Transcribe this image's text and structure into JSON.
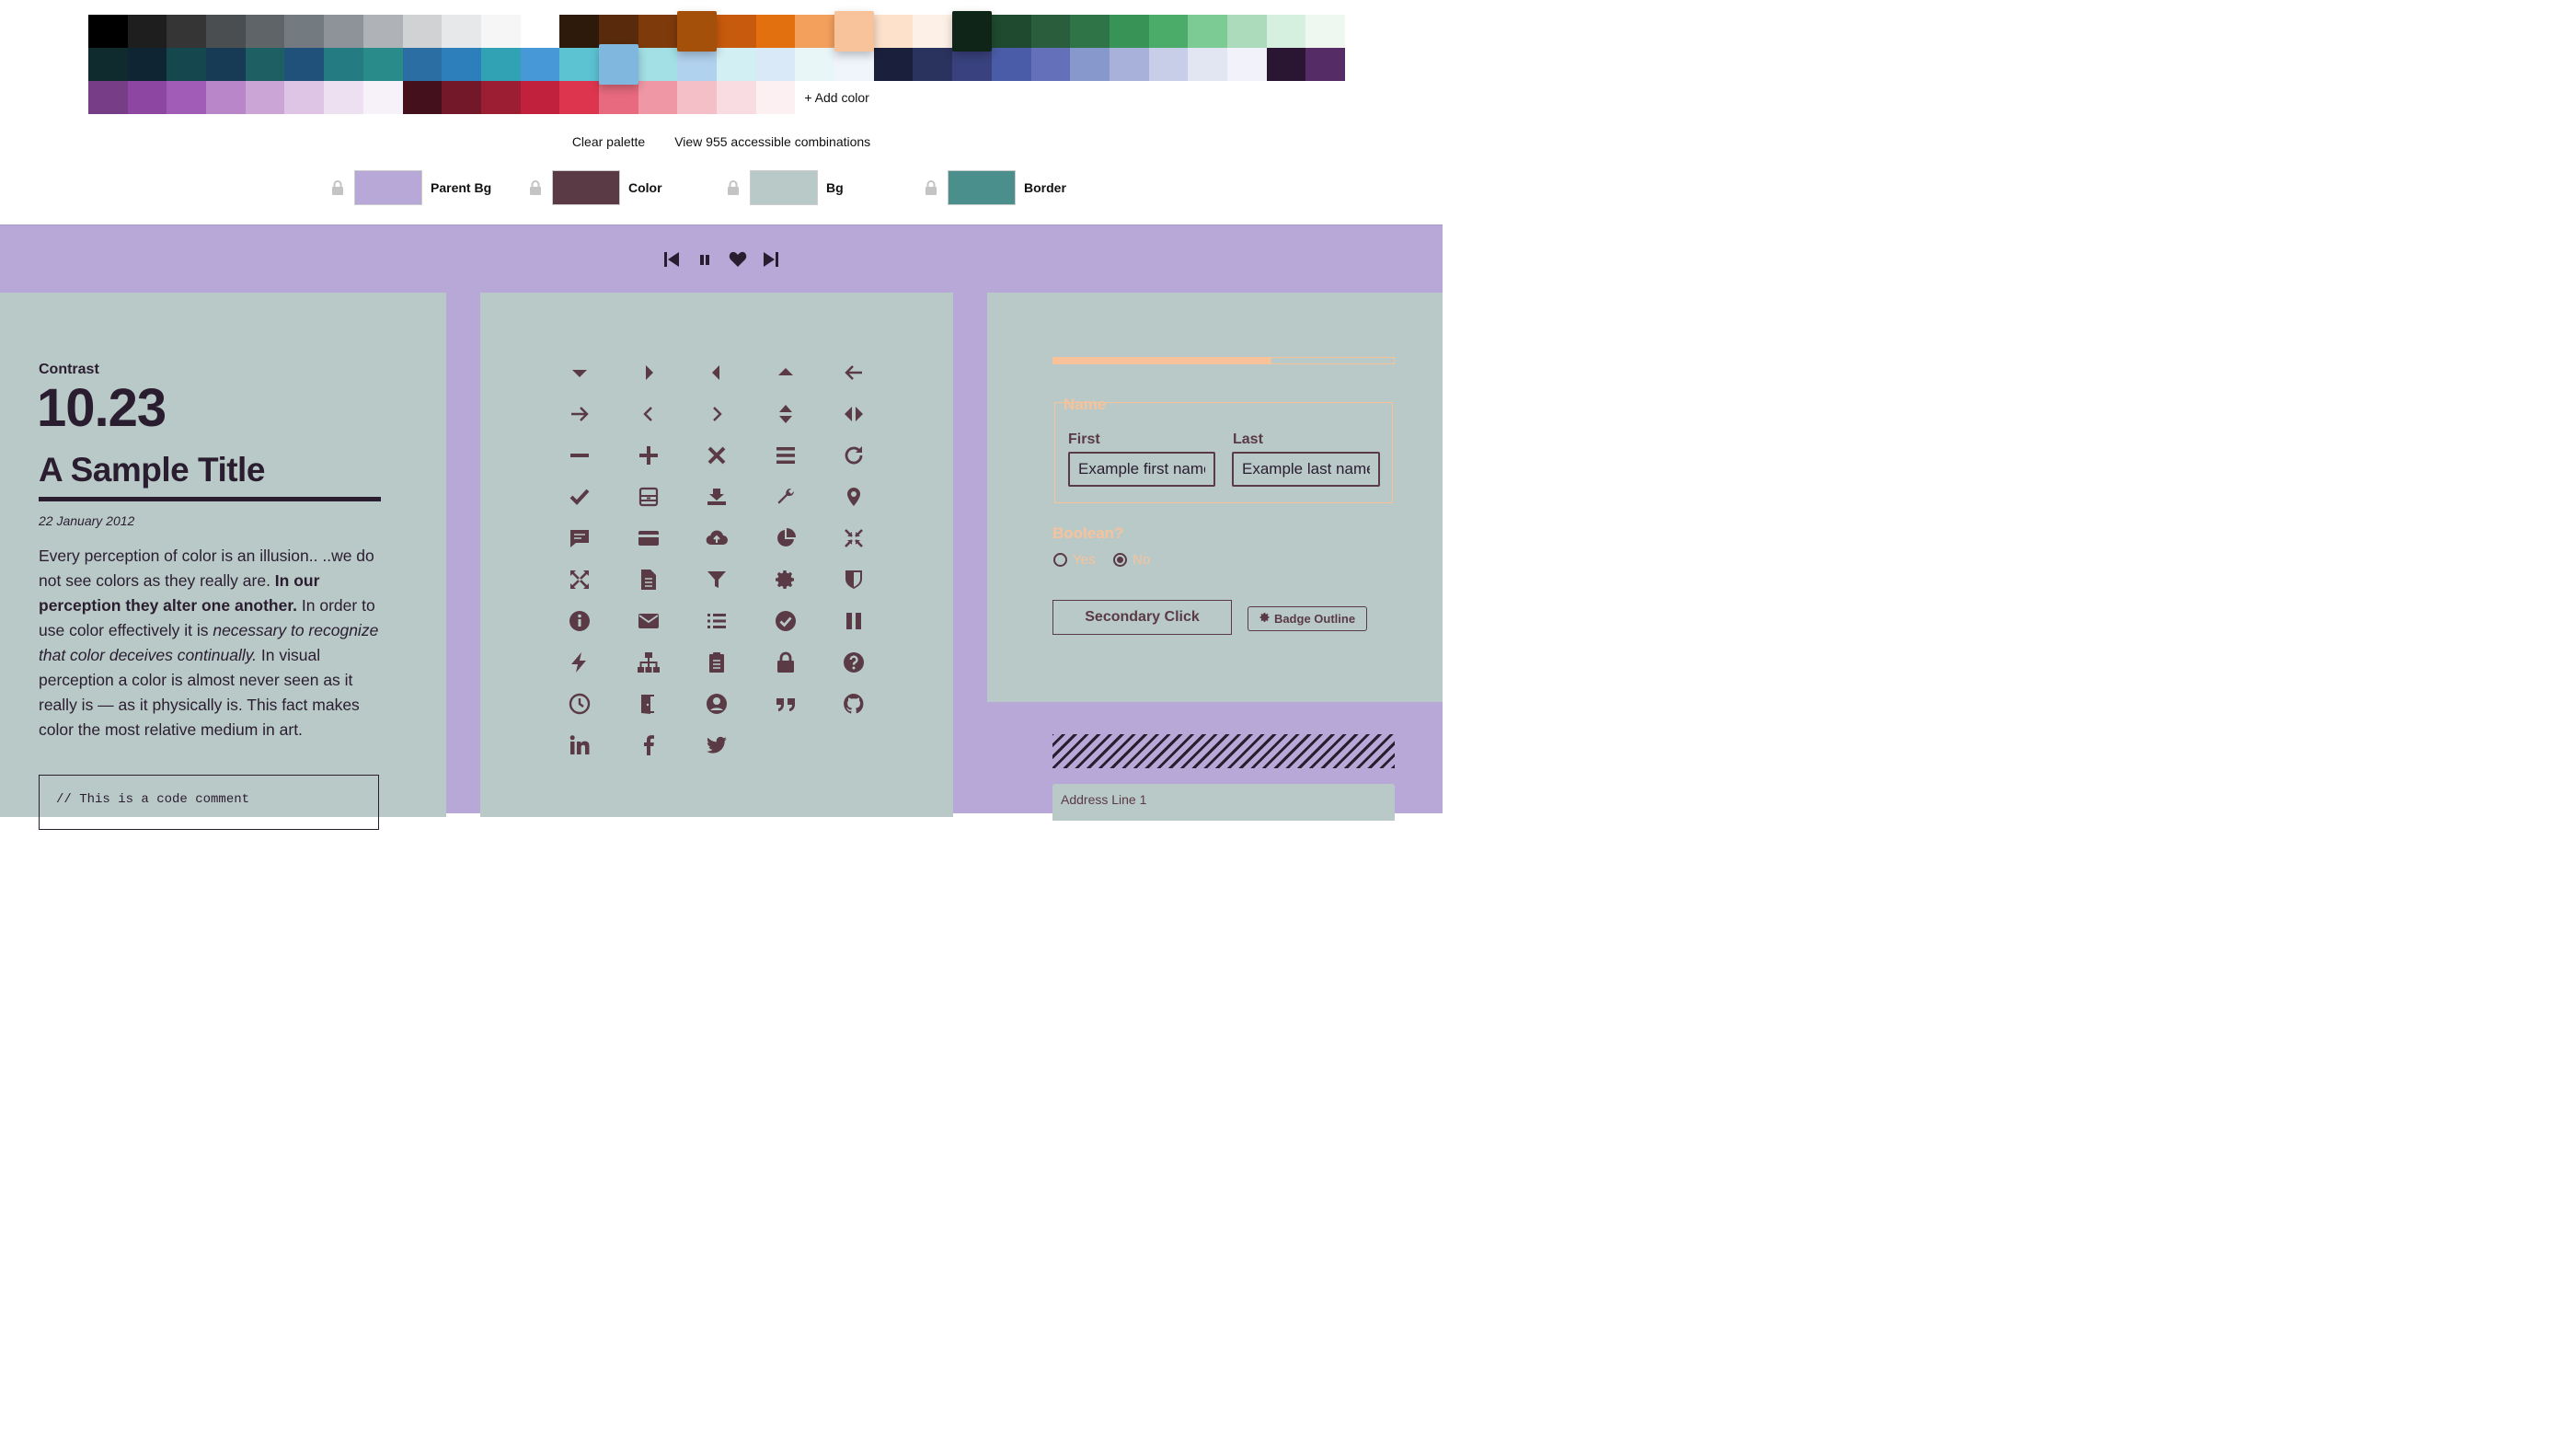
{
  "palette": {
    "rows": [
      [
        "#000000",
        "#1e1e1e",
        "#353535",
        "#4a4e51",
        "#5e6468",
        "#737b80",
        "#8d9398",
        "#afb2b6",
        "#d1d2d4",
        "#e6e8e9",
        "#f6f6f6",
        "#ffffff",
        "#2e1a0b",
        "#5a2a0c",
        "#7f3a0b",
        "#a4500b",
        "#c85a0e",
        "#e3700f",
        "#f4a05d",
        "#f8c39a",
        "#fde1cb",
        "#fdf1e7",
        "#0f2518",
        "#1f4a2f",
        "#2a5d3b",
        "#2f7446",
        "#389356",
        "#4bab68",
        "#7ccb94",
        "#acdbbb",
        "#d5f0df",
        "#eef8f1"
      ],
      [
        "#0f2b2e",
        "#0f2533",
        "#15474e",
        "#183b55",
        "#1e5f63",
        "#20517b",
        "#247b82",
        "#2a8b8b",
        "#2a6ea3",
        "#2c7fba",
        "#30a2b3",
        "#4699d6",
        "#5cc3d3",
        "#7fb7de",
        "#a2e0e6",
        "#b1d2ee",
        "#d2eff4",
        "#dae9f7",
        "#e9f6f8",
        "#f0f5fb",
        "#1a1f3b",
        "#2a335e",
        "#39427e",
        "#4a5ca8",
        "#6470ba",
        "#8798cc",
        "#a7b1da",
        "#c8cde8",
        "#e2e5f2",
        "#f2f3fa",
        "#2a1632",
        "#552c66"
      ],
      [
        "#773d87",
        "#8e46a3",
        "#a05cb6",
        "#b987c9",
        "#caa5d6",
        "#dec5e6",
        "#ede0f1",
        "#f7f1f9",
        "#44101b",
        "#731828",
        "#9c1e33",
        "#c1213d",
        "#de354f",
        "#e86a7e",
        "#f097a5",
        "#f5bfc7",
        "#f9dce1",
        "#fcf0f2"
      ]
    ],
    "raised": [
      [
        0,
        15
      ],
      [
        0,
        19
      ],
      [
        0,
        22
      ],
      [
        1,
        13
      ]
    ],
    "add_color_label": "+ Add color",
    "clear_label": "Clear palette",
    "combinations_label": "View 955 accessible combinations"
  },
  "roles": [
    {
      "label": "Parent Bg",
      "color": "#b8a8d7"
    },
    {
      "label": "Color",
      "color": "#5a3a45"
    },
    {
      "label": "Bg",
      "color": "#b9c9c7"
    },
    {
      "label": "Border",
      "color": "#4a8f8c"
    }
  ],
  "theme": {
    "parent_bg": "#b8a8d7",
    "color": "#5a3a45",
    "bg": "#b9c9c7",
    "accent": "#f8c39a",
    "ink": "#2a1d30"
  },
  "player": {
    "icons": [
      "skip-back-icon",
      "pause-icon",
      "heart-icon",
      "skip-forward-icon"
    ]
  },
  "left_panel": {
    "contrast_label": "Contrast",
    "contrast_value": "10.23",
    "title": "A Sample Title",
    "date": "22 January 2012",
    "paragraph": [
      {
        "text": "Every perception of color is an illusion.. ..we do not see colors as they really are. ",
        "style": "normal"
      },
      {
        "text": "In our perception they alter one another.",
        "style": "bold"
      },
      {
        "text": " In order to use color effectively it is ",
        "style": "normal"
      },
      {
        "text": "necessary to recognize that color deceives continually.",
        "style": "italic"
      },
      {
        "text": " In visual perception a color is almost never seen as it really is — as it physically is. This fact makes color the most relative medium in art.",
        "style": "normal"
      }
    ],
    "code_comment": "// This is a code comment"
  },
  "icons": [
    "caret-down-icon",
    "caret-right-icon",
    "caret-left-icon",
    "caret-up-icon",
    "arrow-left-icon",
    "arrow-right-icon",
    "chevron-left-icon",
    "chevron-right-icon",
    "sort-icon",
    "code-arrows-icon",
    "minus-icon",
    "plus-icon",
    "close-icon",
    "menu-icon",
    "refresh-icon",
    "check-icon",
    "archive-icon",
    "download-tray-icon",
    "wrench-icon",
    "location-pin-icon",
    "comment-icon",
    "credit-card-icon",
    "cloud-upload-icon",
    "pie-chart-icon",
    "compress-icon",
    "expand-icon",
    "document-icon",
    "filter-icon",
    "gear-icon",
    "shield-icon",
    "info-icon",
    "mail-icon",
    "list-icon",
    "check-circle-icon",
    "pause-bars-icon",
    "bolt-icon",
    "sitemap-icon",
    "clipboard-icon",
    "lock-icon",
    "question-icon",
    "clock-icon",
    "door-exit-icon",
    "user-circle-icon",
    "quote-icon",
    "github-icon",
    "linkedin-icon",
    "facebook-icon",
    "twitter-icon"
  ],
  "form": {
    "progress": 0.64,
    "legend": "Name",
    "first_label": "First",
    "first_value": "Example first name",
    "last_label": "Last",
    "last_value": "Example last name",
    "boolean_label": "Boolean?",
    "yes_label": "Yes",
    "no_label": "No",
    "selected": "No",
    "secondary_button": "Secondary Click",
    "badge_label": "Badge Outline",
    "address_placeholder": "Address Line 1"
  }
}
